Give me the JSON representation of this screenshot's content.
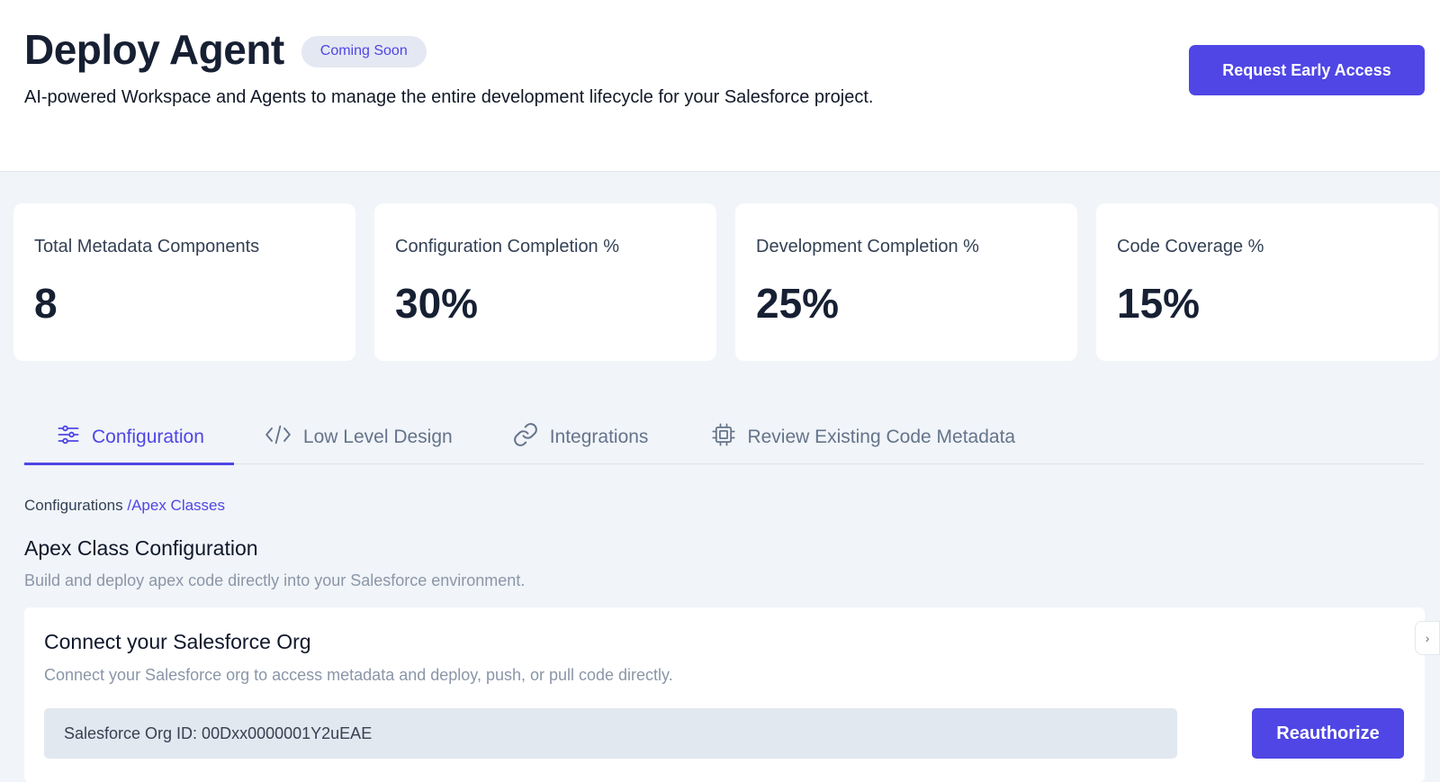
{
  "header": {
    "title": "Deploy Agent",
    "badge": "Coming Soon",
    "subtitle": "AI-powered Workspace and Agents to manage the entire development lifecycle for your Salesforce project.",
    "cta_label": "Request Early Access"
  },
  "stats": [
    {
      "label": "Total Metadata Components",
      "value": "8"
    },
    {
      "label": "Configuration Completion %",
      "value": "30%"
    },
    {
      "label": "Development Completion %",
      "value": "25%"
    },
    {
      "label": "Code Coverage %",
      "value": "15%"
    }
  ],
  "tabs": [
    {
      "label": "Configuration",
      "icon": "sliders-icon",
      "active": true
    },
    {
      "label": "Low Level Design",
      "icon": "code-icon",
      "active": false
    },
    {
      "label": "Integrations",
      "icon": "link-icon",
      "active": false
    },
    {
      "label": "Review Existing Code Metadata",
      "icon": "chip-icon",
      "active": false
    }
  ],
  "breadcrumb": {
    "root": "Configurations",
    "current": "/Apex Classes"
  },
  "section": {
    "title": "Apex Class Configuration",
    "subtitle": "Build and deploy apex code directly into your Salesforce environment."
  },
  "connect": {
    "title": "Connect your Salesforce Org",
    "subtitle": "Connect your Salesforce org to access metadata and deploy, push, or pull code directly.",
    "org_id": "Salesforce Org ID: 00Dxx0000001Y2uEAE",
    "button_label": "Reauthorize"
  },
  "colors": {
    "accent": "#4f46e5",
    "background": "#f1f4f8"
  }
}
